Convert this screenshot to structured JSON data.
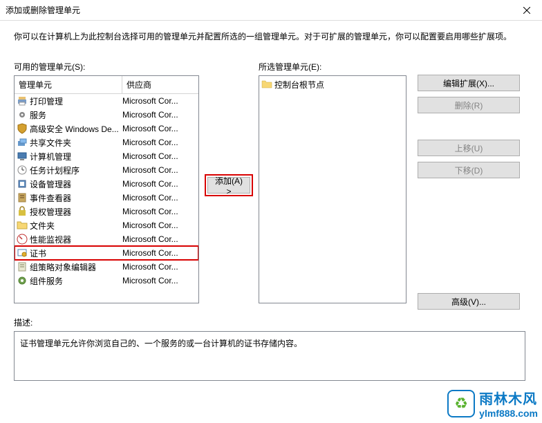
{
  "window": {
    "title": "添加或删除管理单元"
  },
  "instruction": "你可以在计算机上为此控制台选择可用的管理单元并配置所选的一组管理单元。对于可扩展的管理单元，你可以配置要启用哪些扩展项。",
  "available": {
    "label": "可用的管理单元(S):",
    "columns": {
      "name": "管理单元",
      "vendor": "供应商"
    },
    "items": [
      {
        "name": "打印管理",
        "vendor": "Microsoft Cor...",
        "icon": "printer-icon"
      },
      {
        "name": "服务",
        "vendor": "Microsoft Cor...",
        "icon": "gear-icon"
      },
      {
        "name": "高级安全 Windows De...",
        "vendor": "Microsoft Cor...",
        "icon": "shield-icon"
      },
      {
        "name": "共享文件夹",
        "vendor": "Microsoft Cor...",
        "icon": "share-icon"
      },
      {
        "name": "计算机管理",
        "vendor": "Microsoft Cor...",
        "icon": "computer-icon"
      },
      {
        "name": "任务计划程序",
        "vendor": "Microsoft Cor...",
        "icon": "task-icon"
      },
      {
        "name": "设备管理器",
        "vendor": "Microsoft Cor...",
        "icon": "device-icon"
      },
      {
        "name": "事件查看器",
        "vendor": "Microsoft Cor...",
        "icon": "event-icon"
      },
      {
        "name": "授权管理器",
        "vendor": "Microsoft Cor...",
        "icon": "auth-icon"
      },
      {
        "name": "文件夹",
        "vendor": "Microsoft Cor...",
        "icon": "folder-icon"
      },
      {
        "name": "性能监视器",
        "vendor": "Microsoft Cor...",
        "icon": "perf-icon"
      },
      {
        "name": "证书",
        "vendor": "Microsoft Cor...",
        "icon": "cert-icon",
        "selected": true
      },
      {
        "name": "组策略对象编辑器",
        "vendor": "Microsoft Cor...",
        "icon": "policy-icon"
      },
      {
        "name": "组件服务",
        "vendor": "Microsoft Cor...",
        "icon": "component-icon"
      }
    ]
  },
  "selected": {
    "label": "所选管理单元(E):",
    "root": "控制台根节点"
  },
  "buttons": {
    "add": "添加(A) >",
    "edit_ext": "编辑扩展(X)...",
    "remove": "删除(R)",
    "move_up": "上移(U)",
    "move_down": "下移(D)",
    "advanced": "高级(V)..."
  },
  "description": {
    "label": "描述:",
    "text": "证书管理单元允许你浏览自己的、一个服务的或一台计算机的证书存储内容。"
  },
  "watermark": {
    "cn": "雨林木风",
    "url": "ylmf888.com"
  }
}
